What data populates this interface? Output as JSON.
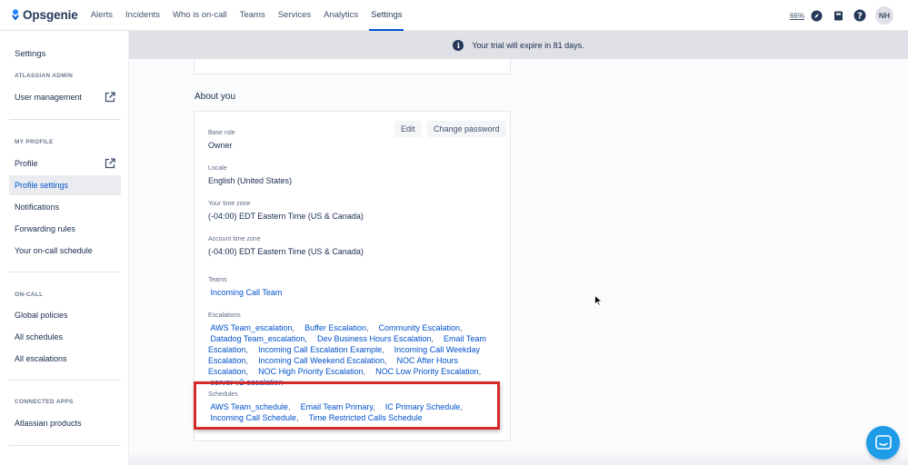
{
  "app": {
    "name": "Opsgenie",
    "nav": [
      "Alerts",
      "Incidents",
      "Who is on-call",
      "Teams",
      "Services",
      "Analytics",
      "Settings"
    ],
    "active_nav": "Settings",
    "battery": "66%",
    "user_initials": "NH",
    "brand_color": "#0052cc"
  },
  "banner": {
    "icon": "info-icon",
    "text": "Your trial will expire in 81 days."
  },
  "sidebar": {
    "title": "Settings",
    "sections": {
      "admin": {
        "heading": "ATLASSIAN ADMIN",
        "items": [
          "User management"
        ]
      },
      "profile": {
        "heading": "MY PROFILE",
        "items": [
          "Profile",
          "Profile settings",
          "Notifications",
          "Forwarding rules",
          "Your on-call schedule"
        ]
      },
      "oncall": {
        "heading": "ON-CALL",
        "items": [
          "Global policies",
          "All schedules",
          "All escalations"
        ]
      },
      "connected": {
        "heading": "CONNECTED APPS",
        "items": [
          "Atlassian products"
        ]
      }
    },
    "selected": "Profile settings"
  },
  "about": {
    "title": "About you",
    "edit_label": "Edit",
    "change_password_label": "Change password",
    "base_role_label": "Base role",
    "base_role": "Owner",
    "locale_label": "Locale",
    "locale": "English (United States)",
    "tz_label": "Your time zone",
    "tz": "(-04:00) EDT Eastern Time (US & Canada)",
    "account_tz_label": "Account time zone",
    "account_tz": "(-04:00) EDT Eastern Time (US & Canada)",
    "teams_label": "Teams",
    "teams": [
      "Incoming Call Team"
    ],
    "escalations_label": "Escalations",
    "escalations": [
      "AWS Team_escalation",
      "Buffer Escalation",
      "Community Escalation",
      "Datadog Team_escalation",
      "Dev Business Hours Escalation",
      "Email Team Escalation",
      "Incoming Call Escalation Example",
      "Incoming Call Weekday Escalation",
      "Incoming Call Weekend Escalation",
      "NOC After Hours Escalation",
      "NOC High Priority Escalation",
      "NOC Low Priority Escalation",
      "server v2 escalation"
    ],
    "schedules_label": "Schedules",
    "schedules": [
      "AWS Team_schedule",
      "Email Team Primary",
      "IC Primary Schedule",
      "Incoming Call Schedule",
      "Time Restricted Calls Schedule"
    ]
  }
}
